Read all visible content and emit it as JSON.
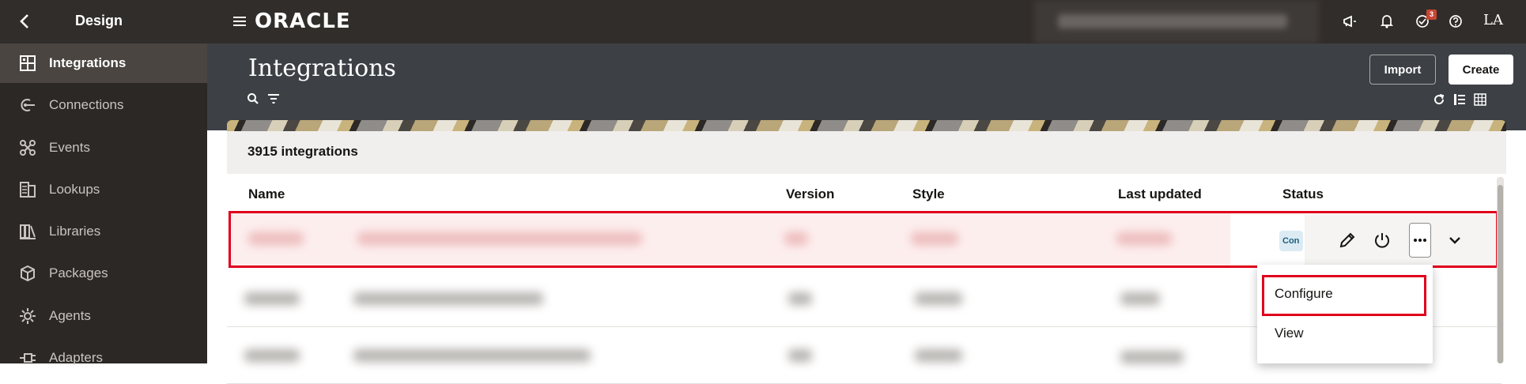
{
  "topbar": {
    "section_title": "Design",
    "logo_text": "ORACLE",
    "notification_badge": "3",
    "avatar_initials": "LA",
    "icons": [
      "back-icon",
      "hamburger-icon",
      "announcement-icon",
      "bell-icon",
      "activity-icon",
      "help-icon"
    ]
  },
  "sidebar": {
    "items": [
      {
        "label": "Integrations",
        "icon": "integrations-icon",
        "active": true
      },
      {
        "label": "Connections",
        "icon": "connections-icon",
        "active": false
      },
      {
        "label": "Events",
        "icon": "events-icon",
        "active": false
      },
      {
        "label": "Lookups",
        "icon": "lookups-icon",
        "active": false
      },
      {
        "label": "Libraries",
        "icon": "libraries-icon",
        "active": false
      },
      {
        "label": "Packages",
        "icon": "packages-icon",
        "active": false
      },
      {
        "label": "Agents",
        "icon": "agents-icon",
        "active": false
      },
      {
        "label": "Adapters",
        "icon": "adapters-icon",
        "active": false
      }
    ]
  },
  "header": {
    "title": "Integrations",
    "import_label": "Import",
    "create_label": "Create"
  },
  "list": {
    "count_text": "3915 integrations",
    "columns": [
      "Name",
      "Version",
      "Style",
      "Last updated",
      "Status"
    ],
    "first_row_status": "Con"
  },
  "row_menu": {
    "items": [
      "Configure",
      "View"
    ]
  },
  "colors": {
    "topbar_bg": "#312d2a",
    "sidebar_bg": "#2b2825",
    "header_bg": "#3d4045",
    "highlight_red": "#e0001b"
  }
}
